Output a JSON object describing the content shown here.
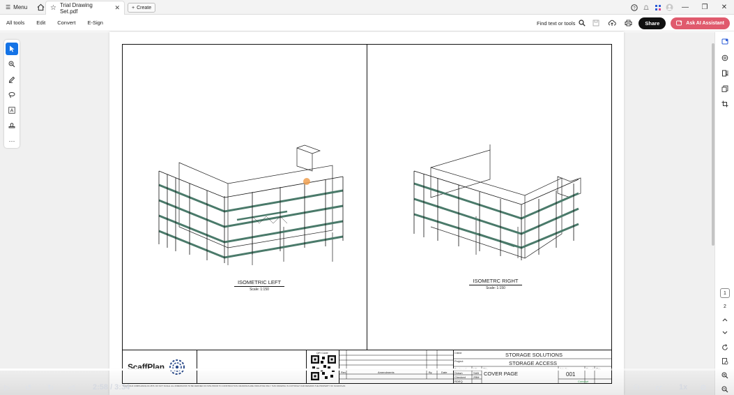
{
  "window": {
    "menu_label": "Menu",
    "tab_title": "Trial Drawing Set.pdf",
    "tab_close": "✕",
    "create_label": "Create"
  },
  "toolbar": {
    "menu": [
      "All tools",
      "Edit",
      "Convert",
      "E-Sign"
    ],
    "find_label": "Find text or tools",
    "share_label": "Share",
    "ai_label": "Ask AI Assistant"
  },
  "right_rail": {
    "pages": [
      "1",
      "2"
    ],
    "current_page": "1"
  },
  "drawing": {
    "left_view_title": "ISOMETRIC LEFT",
    "left_view_scale": "Scale: 1:150",
    "right_view_title": "ISOMETRC RIGHT",
    "right_view_scale": "Scale: 1:150",
    "logo_text": "ScaffPlan",
    "qr_label": "QR Code",
    "amend_headers": [
      "Rev",
      "Amendments",
      "By",
      "Date"
    ],
    "client_label": "Client",
    "client_value": "STORAGE SOLUTIONS",
    "project_label": "Project",
    "project_value": "STORAGE ACCESS",
    "designed_label": "Designed",
    "designed_value": "HK",
    "drawn_label": "Drawn",
    "drawn_value": "SAB",
    "checked_label": "Checked",
    "checked_value": "ZBM",
    "rev_label": "RDEQ",
    "title_label": "Title",
    "title_value": "COVER PAGE",
    "job_label": "Job No.",
    "job_value": "001",
    "drawing_no_label": "Drawing No.",
    "rev_col_label": "Rev",
    "status_value": "Concept",
    "footer_note": "SCAFFOLD COMPLIANCE AS 4576. DO NOT SCALE. ALL DIMENSIONS TO BE VERIFIED ON SITE PRIOR TO CONSTRUCTION. DRAWINGS ARE INDICATIVE ONLY. THIS DRAWING IS COPYRIGHT AND REMAINS THE PROPERTY OF SCAFFPLAN."
  },
  "video": {
    "time": "2:58 / 3:34",
    "speed": "1x",
    "progress": 0.83
  },
  "colors": {
    "accent_blue": "#1473e6",
    "ai_button": "#e05a6d",
    "scaffold_deck": "#4a7a6a"
  }
}
